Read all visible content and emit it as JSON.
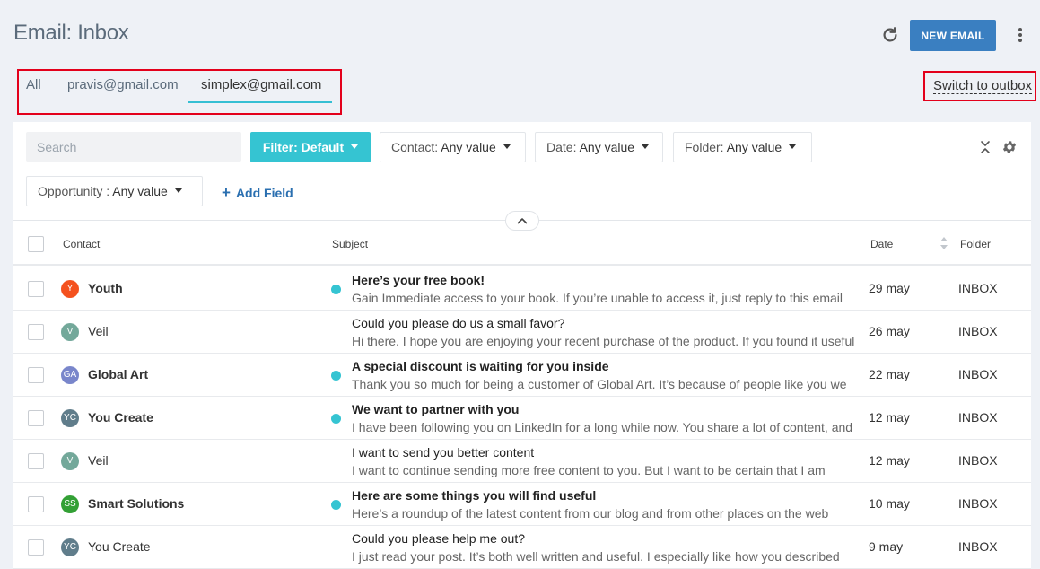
{
  "header": {
    "title": "Email: Inbox",
    "refresh_icon": "refresh-icon",
    "new_email_label": "NEW EMAIL",
    "more_icon": "kebab-icon",
    "accent_color": "#3a7fc1"
  },
  "account_tabs": [
    {
      "label": "All",
      "active": false
    },
    {
      "label": "pravis@gmail.com",
      "active": false
    },
    {
      "label": "simplex@gmail.com",
      "active": true
    }
  ],
  "switch_link": "Switch to outbox",
  "filters": {
    "search_placeholder": "Search",
    "filter_button": "Filter: Default",
    "contact": {
      "label": "Contact:",
      "value": "Any value"
    },
    "date": {
      "label": "Date:",
      "value": "Any value"
    },
    "folder": {
      "label": "Folder:",
      "value": "Any value"
    },
    "opportunity": {
      "label": "Opportunity :",
      "value": "Any value"
    },
    "add_field": "Add Field"
  },
  "table": {
    "headers": {
      "contact": "Contact",
      "subject": "Subject",
      "date": "Date",
      "folder": "Folder"
    },
    "rows": [
      {
        "initials": "Y",
        "avatar_color": "#f4511e",
        "contact": "Youth",
        "unread": true,
        "subject": "Here’s your free book!",
        "preview": "Gain Immediate access to your book. If you’re unable to access it, just reply to this email",
        "date": "29 may",
        "folder": "INBOX"
      },
      {
        "initials": "V",
        "avatar_color": "#73a89a",
        "contact": "Veil",
        "unread": false,
        "subject": "Could you please do us a small favor?",
        "preview": "Hi there. I hope you are enjoying your recent purchase of the product. If you found it useful",
        "date": "26 may",
        "folder": "INBOX"
      },
      {
        "initials": "GA",
        "avatar_color": "#7986cb",
        "contact": "Global Art",
        "unread": true,
        "subject": "A special discount is waiting for you inside",
        "preview": "Thank you so much for being a customer of Global Art. It’s because of people like you we",
        "date": "22 may",
        "folder": "INBOX"
      },
      {
        "initials": "YC",
        "avatar_color": "#607d8b",
        "contact": "You Create",
        "unread": true,
        "subject": "We want to partner with you",
        "preview": "I have been following you on LinkedIn for a long while now. You share a lot of content, and",
        "date": "12 may",
        "folder": "INBOX"
      },
      {
        "initials": "V",
        "avatar_color": "#73a89a",
        "contact": "Veil",
        "unread": false,
        "subject": "I want to send you better content",
        "preview": "I want to continue sending more free content to you. But I want to be certain that I am",
        "date": "12 may",
        "folder": "INBOX"
      },
      {
        "initials": "SS",
        "avatar_color": "#33a035",
        "contact": "Smart Solutions",
        "unread": true,
        "subject": "Here are some things you will find useful",
        "preview": "Here’s a roundup of the latest content from our blog and from other places on the web",
        "date": "10 may",
        "folder": "INBOX"
      },
      {
        "initials": "YC",
        "avatar_color": "#607d8b",
        "contact": "You Create",
        "unread": false,
        "subject": "Could you please help me out?",
        "preview": "I just read your post. It’s both well written and useful. I especially like how you described",
        "date": "9 may",
        "folder": "INBOX"
      }
    ]
  }
}
